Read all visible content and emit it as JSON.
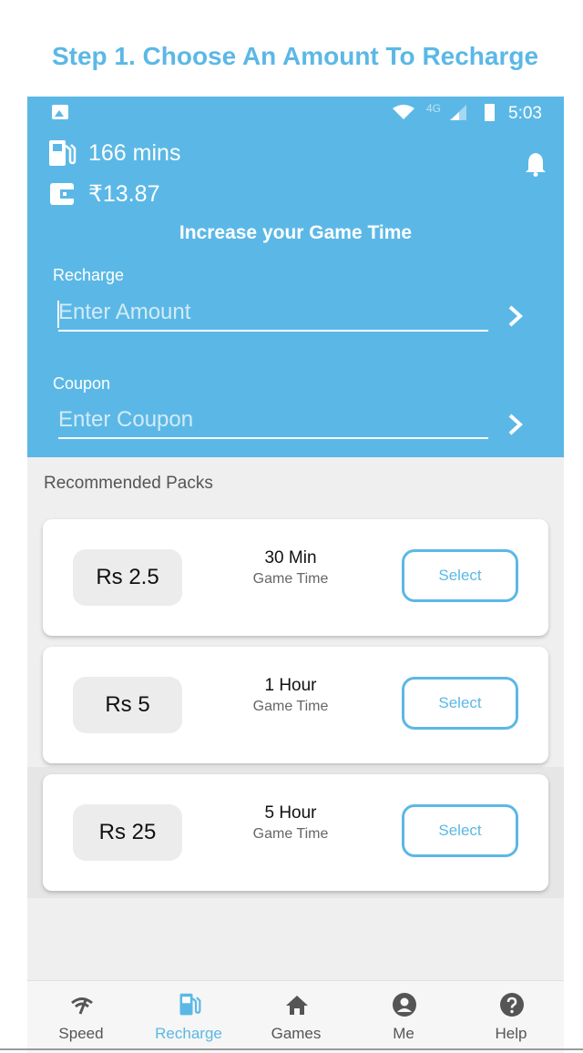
{
  "caption": "Step 1. Choose An Amount To Recharge",
  "status_bar": {
    "network": "4G",
    "time": "5:03"
  },
  "header": {
    "minutes": "166 mins",
    "balance": "₹13.87",
    "title": "Increase your Game Time",
    "recharge_label": "Recharge",
    "recharge_placeholder": "Enter Amount",
    "coupon_label": "Coupon",
    "coupon_placeholder": "Enter Coupon"
  },
  "packs_title": "Recommended Packs",
  "packs": [
    {
      "price": "Rs 2.5",
      "duration": "30 Min",
      "subtitle": "Game Time",
      "button": "Select"
    },
    {
      "price": "Rs 5",
      "duration": "1 Hour",
      "subtitle": "Game Time",
      "button": "Select"
    },
    {
      "price": "Rs 25",
      "duration": "5 Hour",
      "subtitle": "Game Time",
      "button": "Select"
    }
  ],
  "nav": [
    {
      "label": "Speed",
      "icon": "speed-icon"
    },
    {
      "label": "Recharge",
      "icon": "fuel-icon",
      "active": true
    },
    {
      "label": "Games",
      "icon": "home-icon"
    },
    {
      "label": "Me",
      "icon": "account-icon"
    },
    {
      "label": "Help",
      "icon": "help-icon"
    }
  ],
  "colors": {
    "accent": "#5bb8e6",
    "background": "#efefef"
  }
}
